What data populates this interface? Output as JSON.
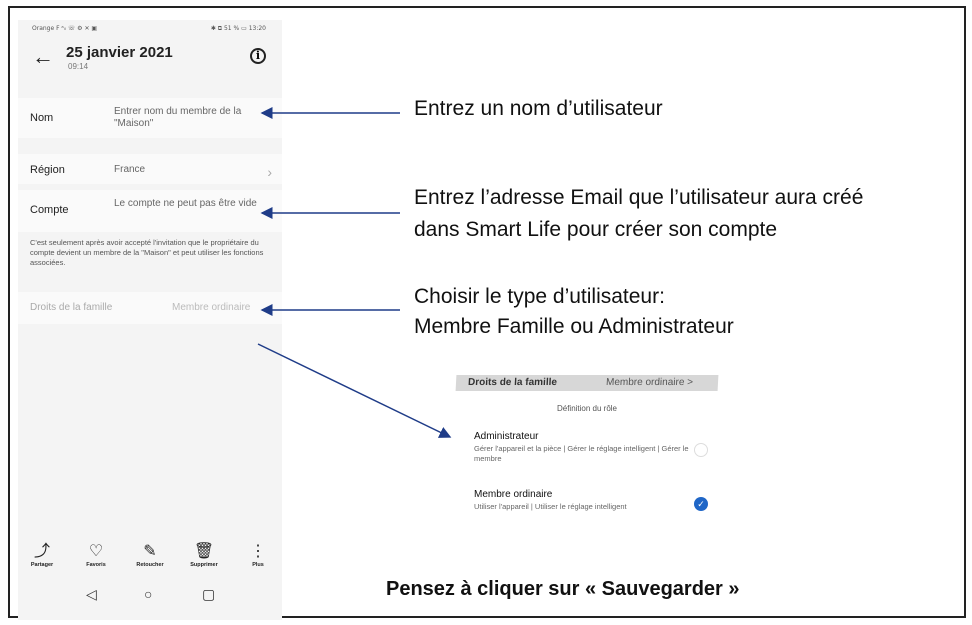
{
  "phone": {
    "status_left": "Orange F ᵃᵢₗ ☏ ⚙ ✕ ▣",
    "status_right": "✱ ⧉ 51 % ▭ 13:20",
    "date": "25 janvier 2021",
    "time": "09:14",
    "rows": {
      "nom_label": "Nom",
      "nom_value": "Entrer nom du membre de la \"Maison\"",
      "region_label": "Région",
      "region_value": "France",
      "compte_label": "Compte",
      "compte_value": "Le compte ne peut pas être vide"
    },
    "note": "C'est seulement après avoir accepté l'invitation que le propriétaire du compte devient un membre de la \"Maison\" et peut utiliser les fonctions associées.",
    "rights_label": "Droits de la famille",
    "rights_value": "Membre ordinaire",
    "toolbar": {
      "share": "Partager",
      "favorites": "Favoris",
      "edit": "Retoucher",
      "delete": "Supprimer",
      "more": "Plus"
    }
  },
  "annotations": {
    "name": "Entrez un nom d’utilisateur",
    "email_line1": "Entrez l’adresse Email que l’utilisateur aura créé",
    "email_line2": "dans Smart Life pour créer son compte",
    "type_line1": "Choisir le type d’utilisateur:",
    "type_line2": "Membre Famille ou Administrateur",
    "save": "Pensez à cliquer sur « Sauvegarder »"
  },
  "popup": {
    "header_label": "Droits de la famille",
    "header_value": "Membre ordinaire >",
    "title": "Définition du rôle",
    "admin_title": "Administrateur",
    "admin_desc": "Gérer l'appareil et la pièce | Gérer le réglage intelligent | Gérer le membre",
    "member_title": "Membre ordinaire",
    "member_desc": "Utiliser l'appareil | Utiliser le réglage intelligent"
  },
  "colors": {
    "arrow": "#1f3c88",
    "check": "#1f66c7"
  }
}
